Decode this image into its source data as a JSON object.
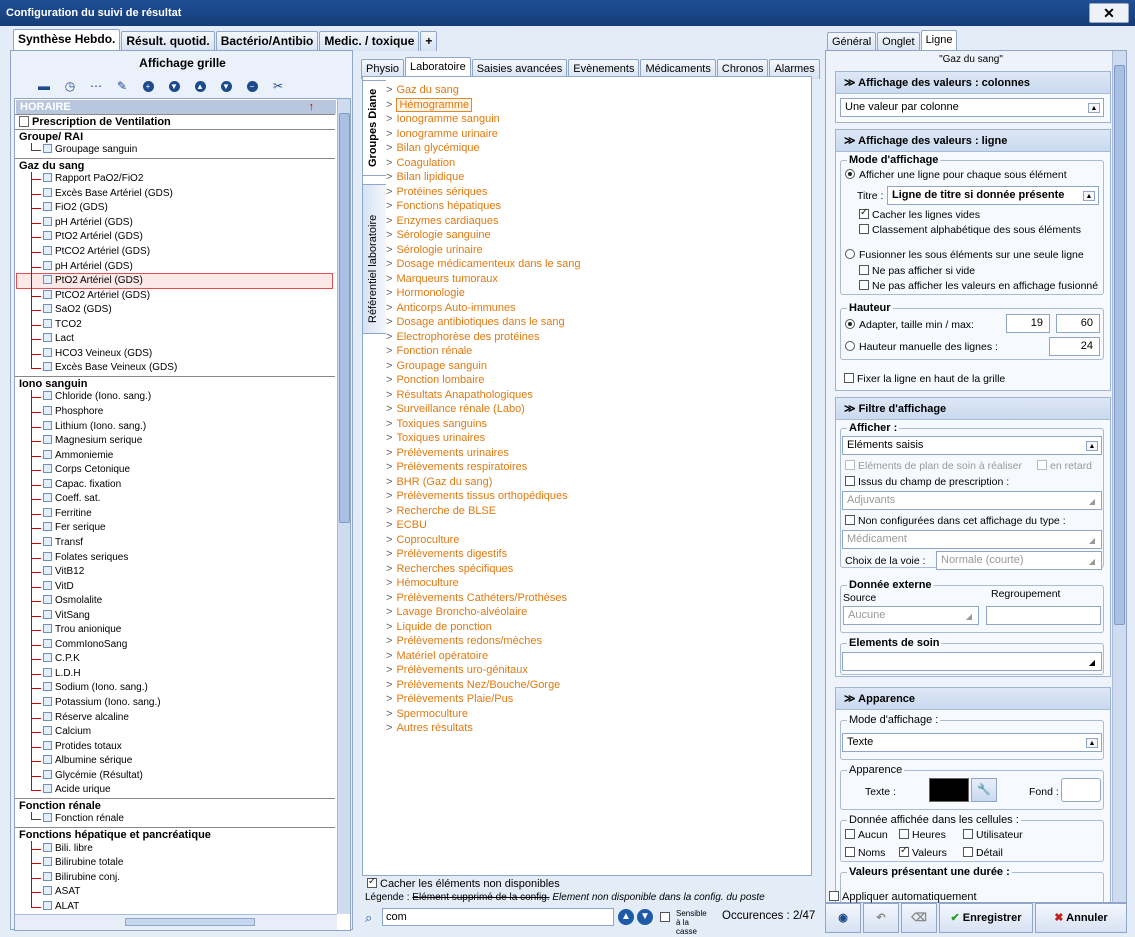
{
  "window": {
    "title": "Configuration du suivi de résultat",
    "close": "✕"
  },
  "left": {
    "tabs": [
      "Synthèse Hebdo.",
      "Résult. quotid.",
      "Bactério/Antibio",
      "Medic. / toxique",
      "+"
    ],
    "header": "Affichage grille",
    "horaire": "HORAIRE",
    "tree": [
      {
        "type": "item0",
        "label": "Prescription de Ventilation"
      },
      {
        "type": "group",
        "label": "Groupe/ RAI"
      },
      {
        "type": "sub",
        "label": "Groupage sanguin"
      },
      {
        "type": "group",
        "label": "Gaz du sang"
      },
      {
        "type": "item",
        "label": "Rapport PaO2/FiO2"
      },
      {
        "type": "item",
        "label": "Excès Base Artériel (GDS)"
      },
      {
        "type": "item",
        "label": "FiO2 (GDS)"
      },
      {
        "type": "item",
        "label": "pH Artériel (GDS)"
      },
      {
        "type": "item",
        "label": "PtO2 Artériel (GDS)"
      },
      {
        "type": "item",
        "label": "PtCO2 Artériel (GDS)"
      },
      {
        "type": "item",
        "label": "pH Artériel (GDS)"
      },
      {
        "type": "item",
        "label": "PtO2 Artériel (GDS)",
        "selected": true
      },
      {
        "type": "item",
        "label": "PtCO2 Artériel (GDS)"
      },
      {
        "type": "item",
        "label": "SaO2 (GDS)"
      },
      {
        "type": "item",
        "label": "TCO2"
      },
      {
        "type": "item",
        "label": "Lact"
      },
      {
        "type": "item",
        "label": "HCO3 Veineux (GDS)"
      },
      {
        "type": "item",
        "label": "Excès Base Veineux (GDS)"
      },
      {
        "type": "group",
        "label": "Iono sanguin"
      },
      {
        "type": "item",
        "label": "Chloride (Iono. sang.)"
      },
      {
        "type": "item",
        "label": "Phosphore"
      },
      {
        "type": "item",
        "label": "Lithium (Iono. sang.)"
      },
      {
        "type": "item",
        "label": "Magnesium serique"
      },
      {
        "type": "item",
        "label": "Ammoniemie"
      },
      {
        "type": "item",
        "label": "Corps Cetonique"
      },
      {
        "type": "item",
        "label": "Capac. fixation"
      },
      {
        "type": "item",
        "label": "Coeff. sat."
      },
      {
        "type": "item",
        "label": "Ferritine"
      },
      {
        "type": "item",
        "label": "Fer serique"
      },
      {
        "type": "item",
        "label": "Transf"
      },
      {
        "type": "item",
        "label": "Folates seriques"
      },
      {
        "type": "item",
        "label": "VitB12"
      },
      {
        "type": "item",
        "label": "VitD"
      },
      {
        "type": "item",
        "label": "Osmolalite"
      },
      {
        "type": "item",
        "label": "VitSang"
      },
      {
        "type": "item",
        "label": "Trou anionique"
      },
      {
        "type": "item",
        "label": "CommIonoSang"
      },
      {
        "type": "item",
        "label": "C.P.K"
      },
      {
        "type": "item",
        "label": "L.D.H"
      },
      {
        "type": "item",
        "label": "Sodium (Iono. sang.)"
      },
      {
        "type": "item",
        "label": "Potassium (Iono. sang.)"
      },
      {
        "type": "item",
        "label": "Réserve alcaline"
      },
      {
        "type": "item",
        "label": "Calcium"
      },
      {
        "type": "item",
        "label": "Protides totaux"
      },
      {
        "type": "item",
        "label": "Albumine sérique"
      },
      {
        "type": "item",
        "label": "Glycémie (Résultat)"
      },
      {
        "type": "item",
        "label": "Acide urique"
      },
      {
        "type": "group",
        "label": "Fonction rénale"
      },
      {
        "type": "sub",
        "label": "Fonction rénale"
      },
      {
        "type": "group",
        "label": "Fonctions hépatique et pancréatique"
      },
      {
        "type": "item",
        "label": "Bili. libre"
      },
      {
        "type": "item",
        "label": "Bilirubine totale"
      },
      {
        "type": "item",
        "label": "Bilirubine conj."
      },
      {
        "type": "item",
        "label": "ASAT"
      },
      {
        "type": "item",
        "label": "ALAT"
      }
    ]
  },
  "middle": {
    "tabs": [
      "Physio",
      "Laboratoire",
      "Saisies avancées",
      "Evènements",
      "Médicaments",
      "Chronos",
      "Alarmes"
    ],
    "vtabs": [
      "Groupes Diane",
      "Référentiel laboratoire"
    ],
    "categories": [
      "Gaz du sang",
      "Hémogramme",
      "Ionogramme sanguin",
      "Ionogramme urinaire",
      "Bilan glycémique",
      "Coagulation",
      "Bilan lipidique",
      "Protéines sériques",
      "Fonctions hépatiques",
      "Enzymes cardiaques",
      "Sérologie sanguine",
      "Sérologie urinaire",
      "Dosage médicamenteux dans le sang",
      "Marqueurs tumoraux",
      "Hormonologie",
      "Anticorps Auto-immunes",
      "Dosage antibiotiques dans le sang",
      "Electrophorèse des protéines",
      "Fonction rénale",
      "Groupage sanguin",
      "Ponction lombaire",
      "Résultats Anapathologiques",
      "Surveillance rénale (Labo)",
      "Toxiques sanguins",
      "Toxiques urinaires",
      "Prélèvements urinaires",
      "Prélèvements respiratoires",
      "BHR (Gaz du sang)",
      "Prélèvements tissus orthopédiques",
      "Recherche de BLSE",
      "ECBU",
      "Coproculture",
      "Prélèvements digestifs",
      "Recherches spécifiques",
      "Hémoculture",
      "Prélèvements Cathéters/Prothèses",
      "Lavage Broncho-alvéolaire",
      "Liquide de ponction",
      "Prélèvements redons/mèches",
      "Matériel opératoire",
      "Prélèvements uro-génitaux",
      "Prélèvements Nez/Bouche/Gorge",
      "Prélèvements Plaie/Pus",
      "Spermoculture",
      "Autres résultats"
    ],
    "hide_unavailable": "Cacher les éléments non disponibles",
    "legend_label": "Légende :",
    "legend_deleted": "Elément supprimé de la config.",
    "legend_unavail": "Element non disponible dans la config. du poste",
    "search_value": "com",
    "case_sensitive": "Sensible à la casse",
    "occurrences": "Occurences : 2/47"
  },
  "right": {
    "tabs": [
      "Général",
      "Onglet",
      "Ligne"
    ],
    "node_title": "\"Gaz du sang\"",
    "sec_cols": "Affichage des valeurs : colonnes",
    "cols_value": "Une valeur par colonne",
    "sec_line": "Affichage des valeurs : ligne",
    "mode_title": "Mode d'affichage",
    "opt_one_line": "Afficher une ligne pour chaque sous élément",
    "titre_label": "Titre :",
    "titre_value": "Ligne de titre si donnée  présente",
    "hide_empty": "Cacher les lignes vides",
    "alpha_sort": "Classement alphabétique des sous  éléments",
    "opt_merge": "Fusionner les sous éléments sur une seule ligne",
    "no_show_empty": "Ne pas afficher si vide",
    "no_show_merged": "Ne pas afficher les valeurs en affichage fusionné",
    "hauteur_title": "Hauteur",
    "adapt_label": "Adapter, taille min / max:",
    "min": "19",
    "max": "60",
    "manual_label": "Hauteur manuelle des lignes :",
    "manual_val": "24",
    "fix_top": "Fixer la ligne en haut de la grille",
    "sec_filter": "Filtre d'affichage",
    "afficher_title": "Afficher :",
    "afficher_value": "Eléments saisis",
    "plan_soin": "Eléments de plan de soin à réaliser",
    "en_retard": "en retard",
    "issus": "Issus du champ de prescription :",
    "adjuvants": "Adjuvants",
    "non_config": "Non configurées dans cet affichage du type :",
    "medicament": "Médicament",
    "voie_label": "Choix de la voie :",
    "voie_value": "Normale (courte)",
    "ext_title": "Donnée externe",
    "source_label": "Source",
    "regroup_label": "Regroupement",
    "source_value": "Aucune",
    "soin_title": "Elements de soin",
    "sec_app": "Apparence",
    "mode_aff_label": "Mode d'affichage :",
    "mode_aff_value": "Texte",
    "app_title": "Apparence",
    "texte_label": "Texte :",
    "fond_label": "Fond :",
    "cells_title": "Donnée affichée dans les cellules :",
    "c_aucun": "Aucun",
    "c_heures": "Heures",
    "c_user": "Utilisateur",
    "c_noms": "Noms",
    "c_valeurs": "Valeurs",
    "c_detail": "Détail",
    "duree_title": "Valeurs présentant une durée :",
    "apply_auto": "Appliquer automatiquement",
    "save": "Enregistrer",
    "cancel": "Annuler"
  }
}
